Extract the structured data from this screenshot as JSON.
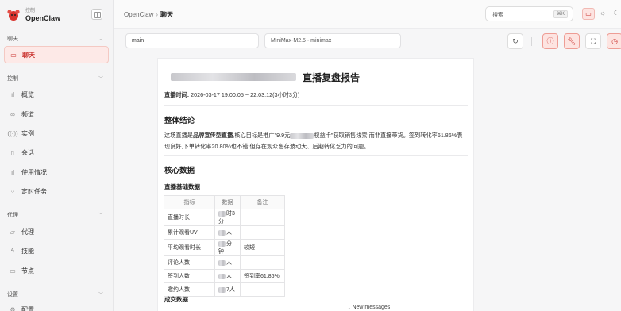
{
  "brand": {
    "sub": "控制",
    "name": "OpenClaw"
  },
  "sidebar": {
    "sections": [
      {
        "title": "聊天"
      },
      {
        "title": "控制"
      },
      {
        "title": "代理"
      },
      {
        "title": "设置"
      }
    ],
    "items": [
      {
        "label": "聊天",
        "icon": "message-icon"
      },
      {
        "label": "概览",
        "icon": "bar-chart-icon"
      },
      {
        "label": "频道",
        "icon": "link-icon"
      },
      {
        "label": "实例",
        "icon": "broadcast-icon"
      },
      {
        "label": "会话",
        "icon": "document-icon"
      },
      {
        "label": "使用情况",
        "icon": "bar-chart-icon"
      },
      {
        "label": "定时任务",
        "icon": "loader-icon"
      },
      {
        "label": "代理",
        "icon": "folder-icon"
      },
      {
        "label": "技能",
        "icon": "zap-icon"
      },
      {
        "label": "节点",
        "icon": "monitor-icon"
      },
      {
        "label": "配置",
        "icon": "gear-icon"
      }
    ]
  },
  "header": {
    "breadcrumb": [
      "OpenClaw",
      "聊天"
    ],
    "search_label": "搜索",
    "search_shortcut": "⌘K"
  },
  "controls": {
    "session": "main",
    "model": "MiniMax-M2.5 · minimax"
  },
  "report": {
    "title": "直播复盘报告",
    "time_label": "直播时间:",
    "time_value": " 2026-03-17 19:00:05 ~ 22:03:12(3小时3分)",
    "section1": "整体结论",
    "summary": {
      "p1": "这场直播是",
      "b1": "品牌宣传型直播",
      "p2": ",核心目标是推广\"9.9元",
      "p3": "权益卡\"获取销售线索,而非直接带货。签到转化率61.86%表现良好,下单转化率20.80%也不错,但存在观众留存波动大、后期转化乏力的问题。"
    },
    "section2": "核心数据",
    "subsection": "直播基础数据",
    "table_headers": [
      "指标",
      "数据",
      "备注"
    ],
    "table_rows": [
      {
        "metric": "直播时长",
        "value": "时3分",
        "note": ""
      },
      {
        "metric": "累计观看UV",
        "value": "人",
        "note": ""
      },
      {
        "metric": "平均观看时长",
        "value": "分钟",
        "note": "较短"
      },
      {
        "metric": "评论人数",
        "value": "人",
        "note": ""
      },
      {
        "metric": "签到人数",
        "value": "人",
        "note": "签到率61.86%"
      },
      {
        "metric": "邀约人数",
        "value": "7人",
        "note": ""
      }
    ],
    "next_subsection": "成交数据"
  },
  "footer": {
    "new_messages": "New messages"
  },
  "colors": {
    "accent": "#c9302c",
    "accent_bg": "#fde9e7"
  }
}
